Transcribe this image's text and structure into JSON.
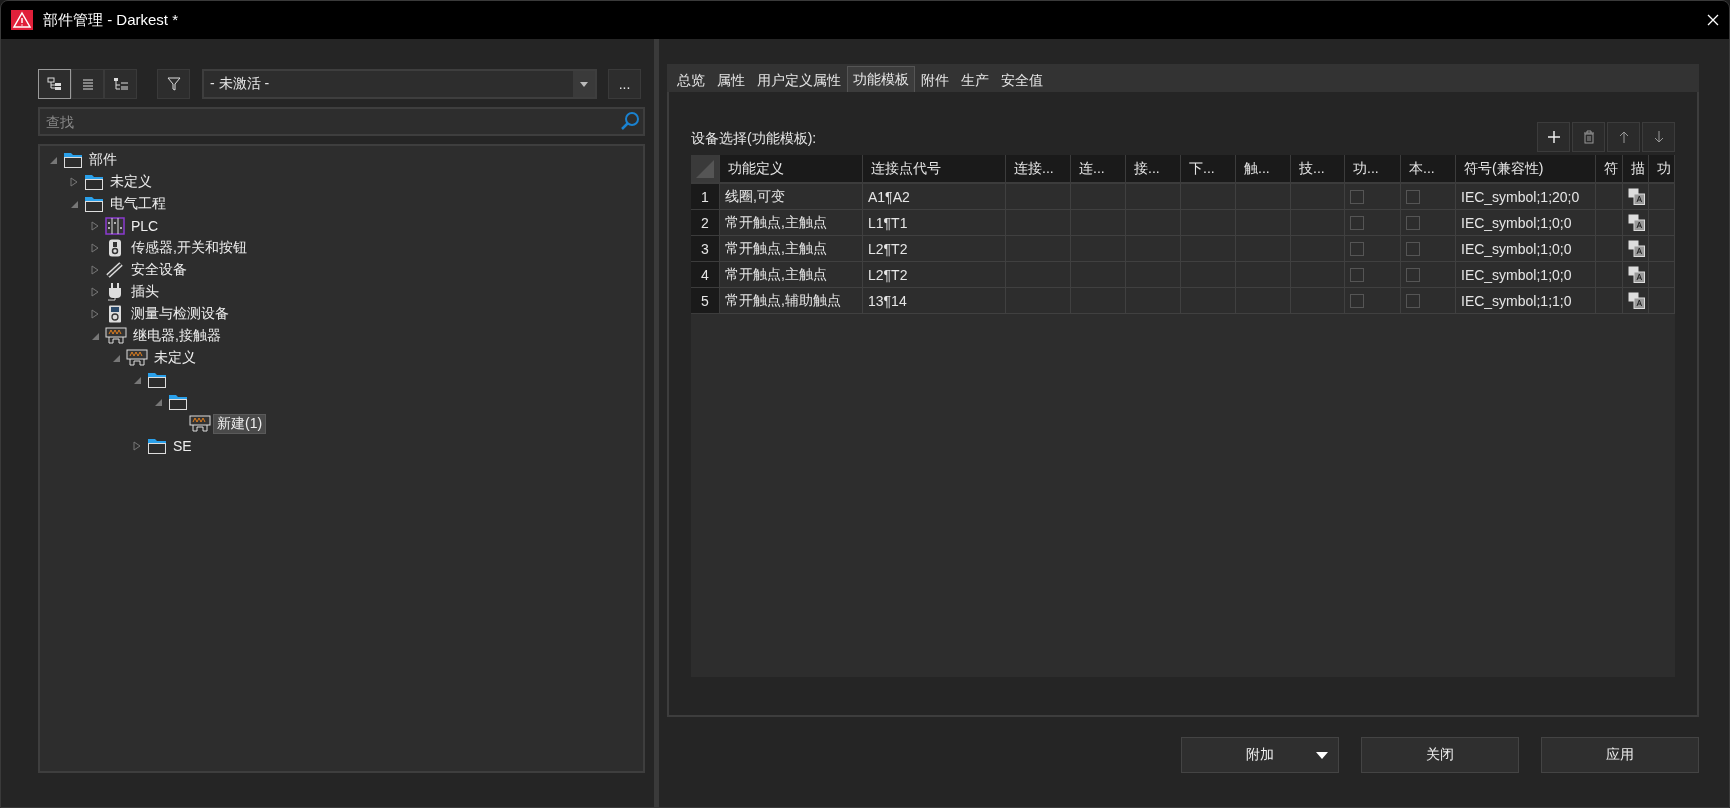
{
  "window": {
    "title": "部件管理 - Darkest *"
  },
  "view_buttons": [
    {
      "kind": "tree",
      "selected": true
    },
    {
      "kind": "list",
      "selected": false
    },
    {
      "kind": "detail",
      "selected": false
    }
  ],
  "filter": {
    "value": "- 未激活 -"
  },
  "more_button": "...",
  "search": {
    "placeholder": "查找"
  },
  "tree": [
    {
      "label": "部件",
      "kind": "folder",
      "expanded": true,
      "selected": false,
      "children": [
        {
          "label": "未定义",
          "kind": "folder",
          "expanded": false,
          "selected": false
        },
        {
          "label": "电气工程",
          "kind": "folder",
          "expanded": true,
          "selected": false,
          "children": [
            {
              "label": "PLC",
              "kind": "plc",
              "expanded": false,
              "selected": false
            },
            {
              "label": "传感器,开关和按钮",
              "kind": "sensor",
              "expanded": false,
              "selected": false
            },
            {
              "label": "安全设备",
              "kind": "fuse",
              "expanded": false,
              "selected": false
            },
            {
              "label": "插头",
              "kind": "plug",
              "expanded": false,
              "selected": false
            },
            {
              "label": "测量与检测设备",
              "kind": "meter",
              "expanded": false,
              "selected": false
            },
            {
              "label": "继电器,接触器",
              "kind": "relay",
              "expanded": true,
              "selected": false,
              "children": [
                {
                  "label": "未定义",
                  "kind": "relay",
                  "expanded": true,
                  "selected": false,
                  "children": [
                    {
                      "kind": "folder",
                      "expanded": true,
                      "children": [
                        {
                          "kind": "folder",
                          "expanded": true,
                          "children": [
                            {
                              "label": "新建(1)",
                              "kind": "relay",
                              "selected": true
                            }
                          ]
                        }
                      ]
                    },
                    {
                      "label": "SE",
                      "kind": "folder",
                      "expanded": false,
                      "selected": false
                    }
                  ]
                }
              ]
            }
          ]
        }
      ]
    }
  ],
  "tabs": [
    {
      "label": "总览",
      "selected": false
    },
    {
      "label": "属性",
      "selected": false
    },
    {
      "label": "用户定义属性",
      "selected": false
    },
    {
      "label": "功能模板",
      "selected": true
    },
    {
      "label": "附件",
      "selected": false
    },
    {
      "label": "生产",
      "selected": false
    },
    {
      "label": "安全值",
      "selected": false
    }
  ],
  "table_label": "设备选择(功能模板):",
  "table_tools": [
    {
      "kind": "add"
    },
    {
      "kind": "delete"
    },
    {
      "kind": "up"
    },
    {
      "kind": "down"
    }
  ],
  "table": {
    "columns": [
      "功能定义",
      "连接点代号",
      "连接...",
      "连...",
      "接...",
      "下...",
      "触...",
      "技...",
      "功...",
      "本...",
      "符号(兼容性)",
      "符",
      "描",
      "功"
    ],
    "rows": [
      {
        "number": "1",
        "cells": [
          {
            "kind": "text",
            "text": "线圈,可变"
          },
          {
            "kind": "text",
            "text": "A1¶A2"
          },
          {
            "kind": "empty"
          },
          {
            "kind": "empty"
          },
          {
            "kind": "empty"
          },
          {
            "kind": "empty"
          },
          {
            "kind": "empty"
          },
          {
            "kind": "empty"
          },
          {
            "kind": "check",
            "checked": false
          },
          {
            "kind": "check",
            "checked": false
          },
          {
            "kind": "text",
            "text": "IEC_symbol;1;20;0"
          },
          {
            "kind": "empty"
          },
          {
            "kind": "icon"
          },
          {
            "kind": "empty"
          }
        ]
      },
      {
        "number": "2",
        "cells": [
          {
            "kind": "text",
            "text": "常开触点,主触点"
          },
          {
            "kind": "text",
            "text": "L1¶T1"
          },
          {
            "kind": "empty"
          },
          {
            "kind": "empty"
          },
          {
            "kind": "empty"
          },
          {
            "kind": "empty"
          },
          {
            "kind": "empty"
          },
          {
            "kind": "empty"
          },
          {
            "kind": "check",
            "checked": false
          },
          {
            "kind": "check",
            "checked": false
          },
          {
            "kind": "text",
            "text": "IEC_symbol;1;0;0"
          },
          {
            "kind": "empty"
          },
          {
            "kind": "icon"
          },
          {
            "kind": "empty"
          }
        ]
      },
      {
        "number": "3",
        "cells": [
          {
            "kind": "text",
            "text": "常开触点,主触点"
          },
          {
            "kind": "text",
            "text": "L2¶T2"
          },
          {
            "kind": "empty"
          },
          {
            "kind": "empty"
          },
          {
            "kind": "empty"
          },
          {
            "kind": "empty"
          },
          {
            "kind": "empty"
          },
          {
            "kind": "empty"
          },
          {
            "kind": "check",
            "checked": false
          },
          {
            "kind": "check",
            "checked": false
          },
          {
            "kind": "text",
            "text": "IEC_symbol;1;0;0"
          },
          {
            "kind": "empty"
          },
          {
            "kind": "icon"
          },
          {
            "kind": "empty"
          }
        ]
      },
      {
        "number": "4",
        "cells": [
          {
            "kind": "text",
            "text": "常开触点,主触点"
          },
          {
            "kind": "text",
            "text": "L2¶T2"
          },
          {
            "kind": "empty"
          },
          {
            "kind": "empty"
          },
          {
            "kind": "empty"
          },
          {
            "kind": "empty"
          },
          {
            "kind": "empty"
          },
          {
            "kind": "empty"
          },
          {
            "kind": "check",
            "checked": false
          },
          {
            "kind": "check",
            "checked": false
          },
          {
            "kind": "text",
            "text": "IEC_symbol;1;0;0"
          },
          {
            "kind": "empty"
          },
          {
            "kind": "icon"
          },
          {
            "kind": "empty"
          }
        ]
      },
      {
        "number": "5",
        "cells": [
          {
            "kind": "text",
            "text": "常开触点,辅助触点"
          },
          {
            "kind": "text",
            "text": "13¶14"
          },
          {
            "kind": "empty"
          },
          {
            "kind": "empty"
          },
          {
            "kind": "empty"
          },
          {
            "kind": "empty"
          },
          {
            "kind": "empty"
          },
          {
            "kind": "empty"
          },
          {
            "kind": "check",
            "checked": false
          },
          {
            "kind": "check",
            "checked": false
          },
          {
            "kind": "text",
            "text": "IEC_symbol;1;1;0"
          },
          {
            "kind": "empty"
          },
          {
            "kind": "icon"
          },
          {
            "kind": "empty"
          }
        ]
      }
    ]
  },
  "buttons": [
    {
      "label": "附加",
      "kind": "dropdown"
    },
    {
      "label": "关闭",
      "kind": "plain"
    },
    {
      "label": "应用",
      "kind": "plain"
    }
  ]
}
